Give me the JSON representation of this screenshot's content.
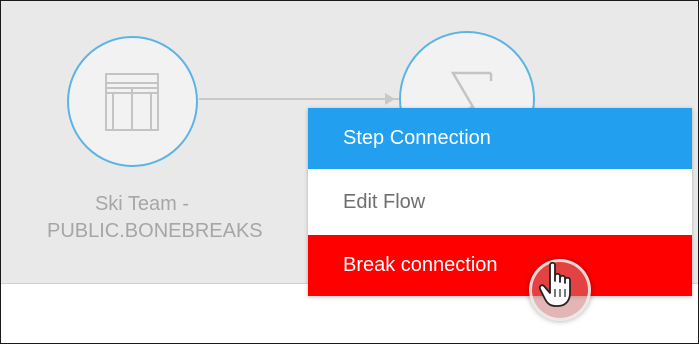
{
  "flow": {
    "source_node": {
      "icon": "table-icon",
      "label_line1": "Ski Team -",
      "label_line2": "PUBLIC.BONEBREAKS"
    },
    "step_node": {
      "icon": "sigma-icon"
    }
  },
  "context_menu": {
    "items": [
      {
        "label": "Step Connection",
        "state": "highlighted",
        "color": "#239ff0"
      },
      {
        "label": "Edit Flow",
        "state": "normal",
        "color": "#ffffff"
      },
      {
        "label": "Break connection",
        "state": "hovered",
        "color": "#ff0000"
      }
    ]
  },
  "cursor": {
    "icon": "hand-pointer-icon"
  },
  "colors": {
    "canvas_background": "#e9e9e9",
    "node_border": "#5db4e4",
    "connector": "#c8c8c8"
  }
}
